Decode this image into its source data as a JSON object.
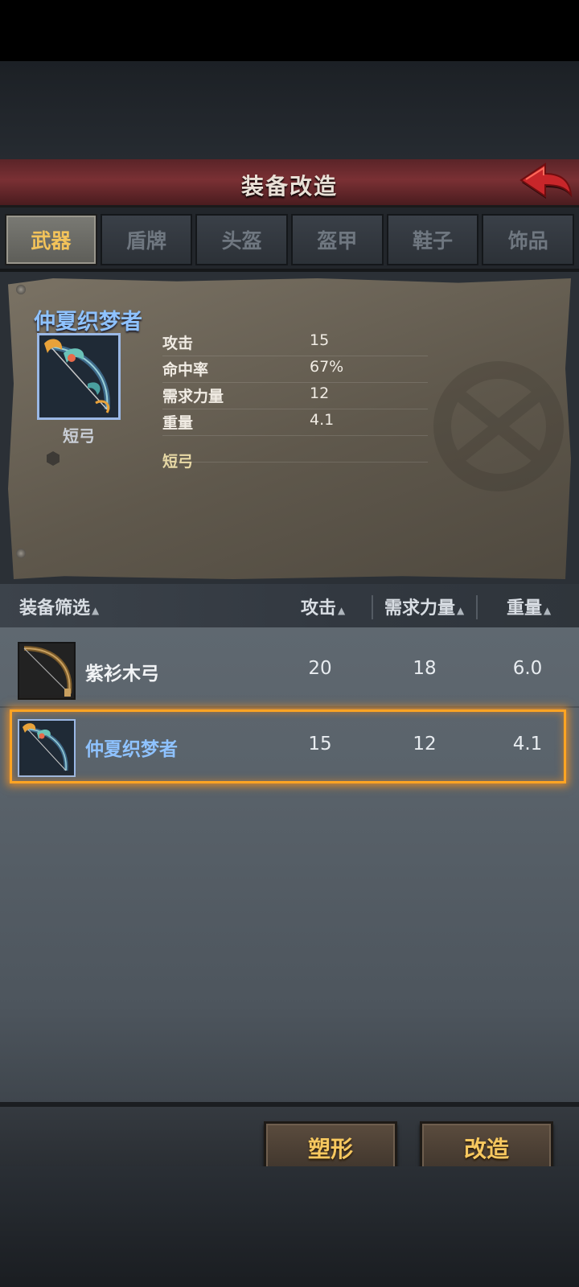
{
  "header": {
    "title": "装备改造"
  },
  "tabs": [
    {
      "label": "武器",
      "active": true
    },
    {
      "label": "盾牌",
      "active": false
    },
    {
      "label": "头盔",
      "active": false
    },
    {
      "label": "盔甲",
      "active": false
    },
    {
      "label": "鞋子",
      "active": false
    },
    {
      "label": "饰品",
      "active": false
    }
  ],
  "detail": {
    "name": "仲夏织梦者",
    "type": "短弓",
    "stats": [
      {
        "label": "攻击",
        "value": "15"
      },
      {
        "label": "命中率",
        "value": "67%"
      },
      {
        "label": "需求力量",
        "value": "12"
      },
      {
        "label": "重量",
        "value": "4.1"
      }
    ],
    "tag": "短弓"
  },
  "list": {
    "headers": {
      "filter": "装备筛选",
      "attack": "攻击",
      "strength": "需求力量",
      "weight": "重量"
    },
    "rows": [
      {
        "name": "紫衫木弓",
        "attack": "20",
        "strength": "18",
        "weight": "6.0",
        "selected": false,
        "name_color": "#f1f3f5"
      },
      {
        "name": "仲夏织梦者",
        "attack": "15",
        "strength": "12",
        "weight": "4.1",
        "selected": true,
        "name_color": "#8ec2ff"
      }
    ]
  },
  "actions": {
    "reshape": "塑形",
    "modify": "改造"
  },
  "colors": {
    "accent_gold": "#f7c85f",
    "selected_glow": "#ffa423",
    "rare_blue": "#8ec2ff"
  }
}
